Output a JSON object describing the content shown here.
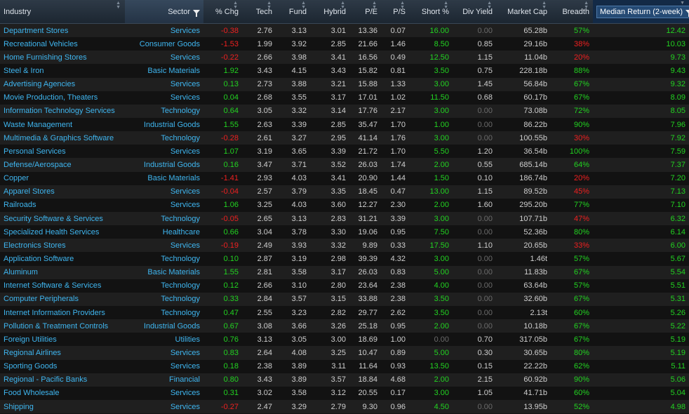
{
  "headers": {
    "industry": "Industry",
    "sector": "Sector",
    "chg": "% Chg",
    "tech": "Tech",
    "fund": "Fund",
    "hybrid": "Hybrid",
    "pe": "P/E",
    "ps": "P/S",
    "short": "Short %",
    "div": "Div Yield",
    "mcap": "Market Cap",
    "breadth": "Breadth",
    "median": "Median Return (2-week)"
  },
  "colors": {
    "positive": "#22d321",
    "negative": "#ef2020",
    "link": "#3fb6f0"
  },
  "rows": [
    {
      "industry": "Department Stores",
      "sector": "Services",
      "chg": "-0.38",
      "tech": "2.76",
      "fund": "3.13",
      "hybrid": "3.01",
      "pe": "13.36",
      "ps": "0.07",
      "short": "16.00",
      "div": "0.00",
      "mcap": "65.28b",
      "breadth": "57%",
      "median": "12.42"
    },
    {
      "industry": "Recreational Vehicles",
      "sector": "Consumer Goods",
      "chg": "-1.53",
      "tech": "1.99",
      "fund": "3.92",
      "hybrid": "2.85",
      "pe": "21.66",
      "ps": "1.46",
      "short": "8.50",
      "div": "0.85",
      "mcap": "29.16b",
      "breadth": "38%",
      "median": "10.03"
    },
    {
      "industry": "Home Furnishing Stores",
      "sector": "Services",
      "chg": "-0.22",
      "tech": "2.66",
      "fund": "3.98",
      "hybrid": "3.41",
      "pe": "16.56",
      "ps": "0.49",
      "short": "12.50",
      "div": "1.15",
      "mcap": "11.04b",
      "breadth": "20%",
      "median": "9.73"
    },
    {
      "industry": "Steel & Iron",
      "sector": "Basic Materials",
      "chg": "1.92",
      "tech": "3.43",
      "fund": "4.15",
      "hybrid": "3.43",
      "pe": "15.82",
      "ps": "0.81",
      "short": "3.50",
      "div": "0.75",
      "mcap": "228.18b",
      "breadth": "88%",
      "median": "9.43"
    },
    {
      "industry": "Advertising Agencies",
      "sector": "Services",
      "chg": "0.13",
      "tech": "2.73",
      "fund": "3.88",
      "hybrid": "3.21",
      "pe": "15.88",
      "ps": "1.33",
      "short": "3.00",
      "div": "1.45",
      "mcap": "56.84b",
      "breadth": "67%",
      "median": "9.32"
    },
    {
      "industry": "Movie Production, Theaters",
      "sector": "Services",
      "chg": "0.04",
      "tech": "2.68",
      "fund": "3.55",
      "hybrid": "3.17",
      "pe": "17.01",
      "ps": "1.02",
      "short": "11.50",
      "div": "0.68",
      "mcap": "60.17b",
      "breadth": "67%",
      "median": "8.09"
    },
    {
      "industry": "Information Technology Services",
      "sector": "Technology",
      "chg": "0.64",
      "tech": "3.05",
      "fund": "3.32",
      "hybrid": "3.14",
      "pe": "17.76",
      "ps": "2.17",
      "short": "3.00",
      "div": "0.00",
      "mcap": "73.08b",
      "breadth": "72%",
      "median": "8.05"
    },
    {
      "industry": "Waste Management",
      "sector": "Industrial Goods",
      "chg": "1.55",
      "tech": "2.63",
      "fund": "3.39",
      "hybrid": "2.85",
      "pe": "35.47",
      "ps": "1.70",
      "short": "1.00",
      "div": "0.00",
      "mcap": "86.22b",
      "breadth": "90%",
      "median": "7.96"
    },
    {
      "industry": "Multimedia & Graphics Software",
      "sector": "Technology",
      "chg": "-0.28",
      "tech": "2.61",
      "fund": "3.27",
      "hybrid": "2.95",
      "pe": "41.14",
      "ps": "1.76",
      "short": "3.00",
      "div": "0.00",
      "mcap": "100.55b",
      "breadth": "30%",
      "median": "7.92"
    },
    {
      "industry": "Personal Services",
      "sector": "Services",
      "chg": "1.07",
      "tech": "3.19",
      "fund": "3.65",
      "hybrid": "3.39",
      "pe": "21.72",
      "ps": "1.70",
      "short": "5.50",
      "div": "1.20",
      "mcap": "36.54b",
      "breadth": "100%",
      "median": "7.59"
    },
    {
      "industry": "Defense/Aerospace",
      "sector": "Industrial Goods",
      "chg": "0.16",
      "tech": "3.47",
      "fund": "3.71",
      "hybrid": "3.52",
      "pe": "26.03",
      "ps": "1.74",
      "short": "2.00",
      "div": "0.55",
      "mcap": "685.14b",
      "breadth": "64%",
      "median": "7.37"
    },
    {
      "industry": "Copper",
      "sector": "Basic Materials",
      "chg": "-1.41",
      "tech": "2.93",
      "fund": "4.03",
      "hybrid": "3.41",
      "pe": "20.90",
      "ps": "1.44",
      "short": "1.50",
      "div": "0.10",
      "mcap": "186.74b",
      "breadth": "20%",
      "median": "7.20"
    },
    {
      "industry": "Apparel Stores",
      "sector": "Services",
      "chg": "-0.04",
      "tech": "2.57",
      "fund": "3.79",
      "hybrid": "3.35",
      "pe": "18.45",
      "ps": "0.47",
      "short": "13.00",
      "div": "1.15",
      "mcap": "89.52b",
      "breadth": "45%",
      "median": "7.13"
    },
    {
      "industry": "Railroads",
      "sector": "Services",
      "chg": "1.06",
      "tech": "3.25",
      "fund": "4.03",
      "hybrid": "3.60",
      "pe": "12.27",
      "ps": "2.30",
      "short": "2.00",
      "div": "1.60",
      "mcap": "295.20b",
      "breadth": "77%",
      "median": "7.10"
    },
    {
      "industry": "Security Software & Services",
      "sector": "Technology",
      "chg": "-0.05",
      "tech": "2.65",
      "fund": "3.13",
      "hybrid": "2.83",
      "pe": "31.21",
      "ps": "3.39",
      "short": "3.00",
      "div": "0.00",
      "mcap": "107.71b",
      "breadth": "47%",
      "median": "6.32"
    },
    {
      "industry": "Specialized Health Services",
      "sector": "Healthcare",
      "chg": "0.66",
      "tech": "3.04",
      "fund": "3.78",
      "hybrid": "3.30",
      "pe": "19.06",
      "ps": "0.95",
      "short": "7.50",
      "div": "0.00",
      "mcap": "52.36b",
      "breadth": "80%",
      "median": "6.14"
    },
    {
      "industry": "Electronics Stores",
      "sector": "Services",
      "chg": "-0.19",
      "tech": "2.49",
      "fund": "3.93",
      "hybrid": "3.32",
      "pe": "9.89",
      "ps": "0.33",
      "short": "17.50",
      "div": "1.10",
      "mcap": "20.65b",
      "breadth": "33%",
      "median": "6.00"
    },
    {
      "industry": "Application Software",
      "sector": "Technology",
      "chg": "0.10",
      "tech": "2.87",
      "fund": "3.19",
      "hybrid": "2.98",
      "pe": "39.39",
      "ps": "4.32",
      "short": "3.00",
      "div": "0.00",
      "mcap": "1.46t",
      "breadth": "57%",
      "median": "5.67"
    },
    {
      "industry": "Aluminum",
      "sector": "Basic Materials",
      "chg": "1.55",
      "tech": "2.81",
      "fund": "3.58",
      "hybrid": "3.17",
      "pe": "26.03",
      "ps": "0.83",
      "short": "5.00",
      "div": "0.00",
      "mcap": "11.83b",
      "breadth": "67%",
      "median": "5.54"
    },
    {
      "industry": "Internet Software & Services",
      "sector": "Technology",
      "chg": "0.12",
      "tech": "2.66",
      "fund": "3.10",
      "hybrid": "2.80",
      "pe": "23.64",
      "ps": "2.38",
      "short": "4.00",
      "div": "0.00",
      "mcap": "63.64b",
      "breadth": "57%",
      "median": "5.51"
    },
    {
      "industry": "Computer Peripherals",
      "sector": "Technology",
      "chg": "0.33",
      "tech": "2.84",
      "fund": "3.57",
      "hybrid": "3.15",
      "pe": "33.88",
      "ps": "2.38",
      "short": "3.50",
      "div": "0.00",
      "mcap": "32.60b",
      "breadth": "67%",
      "median": "5.31"
    },
    {
      "industry": "Internet Information Providers",
      "sector": "Technology",
      "chg": "0.47",
      "tech": "2.55",
      "fund": "3.23",
      "hybrid": "2.82",
      "pe": "29.77",
      "ps": "2.62",
      "short": "3.50",
      "div": "0.00",
      "mcap": "2.13t",
      "breadth": "60%",
      "median": "5.26"
    },
    {
      "industry": "Pollution & Treatment Controls",
      "sector": "Industrial Goods",
      "chg": "0.67",
      "tech": "3.08",
      "fund": "3.66",
      "hybrid": "3.26",
      "pe": "25.18",
      "ps": "0.95",
      "short": "2.00",
      "div": "0.00",
      "mcap": "10.18b",
      "breadth": "67%",
      "median": "5.22"
    },
    {
      "industry": "Foreign Utilities",
      "sector": "Utilities",
      "chg": "0.76",
      "tech": "3.13",
      "fund": "3.05",
      "hybrid": "3.00",
      "pe": "18.69",
      "ps": "1.00",
      "short": "0.00",
      "div": "0.70",
      "mcap": "317.05b",
      "breadth": "67%",
      "median": "5.19"
    },
    {
      "industry": "Regional Airlines",
      "sector": "Services",
      "chg": "0.83",
      "tech": "2.64",
      "fund": "4.08",
      "hybrid": "3.25",
      "pe": "10.47",
      "ps": "0.89",
      "short": "5.00",
      "div": "0.30",
      "mcap": "30.65b",
      "breadth": "80%",
      "median": "5.19"
    },
    {
      "industry": "Sporting Goods",
      "sector": "Services",
      "chg": "0.18",
      "tech": "2.38",
      "fund": "3.89",
      "hybrid": "3.11",
      "pe": "11.64",
      "ps": "0.93",
      "short": "13.50",
      "div": "0.15",
      "mcap": "22.22b",
      "breadth": "62%",
      "median": "5.11"
    },
    {
      "industry": "Regional - Pacific Banks",
      "sector": "Financial",
      "chg": "0.80",
      "tech": "3.43",
      "fund": "3.89",
      "hybrid": "3.57",
      "pe": "18.84",
      "ps": "4.68",
      "short": "2.00",
      "div": "2.15",
      "mcap": "60.92b",
      "breadth": "90%",
      "median": "5.06"
    },
    {
      "industry": "Food Wholesale",
      "sector": "Services",
      "chg": "0.31",
      "tech": "3.02",
      "fund": "3.58",
      "hybrid": "3.12",
      "pe": "20.55",
      "ps": "0.17",
      "short": "3.00",
      "div": "1.05",
      "mcap": "41.71b",
      "breadth": "60%",
      "median": "5.04"
    },
    {
      "industry": "Shipping",
      "sector": "Services",
      "chg": "-0.27",
      "tech": "2.47",
      "fund": "3.29",
      "hybrid": "2.79",
      "pe": "9.30",
      "ps": "0.96",
      "short": "4.50",
      "div": "0.00",
      "mcap": "13.95b",
      "breadth": "52%",
      "median": "4.98"
    }
  ]
}
